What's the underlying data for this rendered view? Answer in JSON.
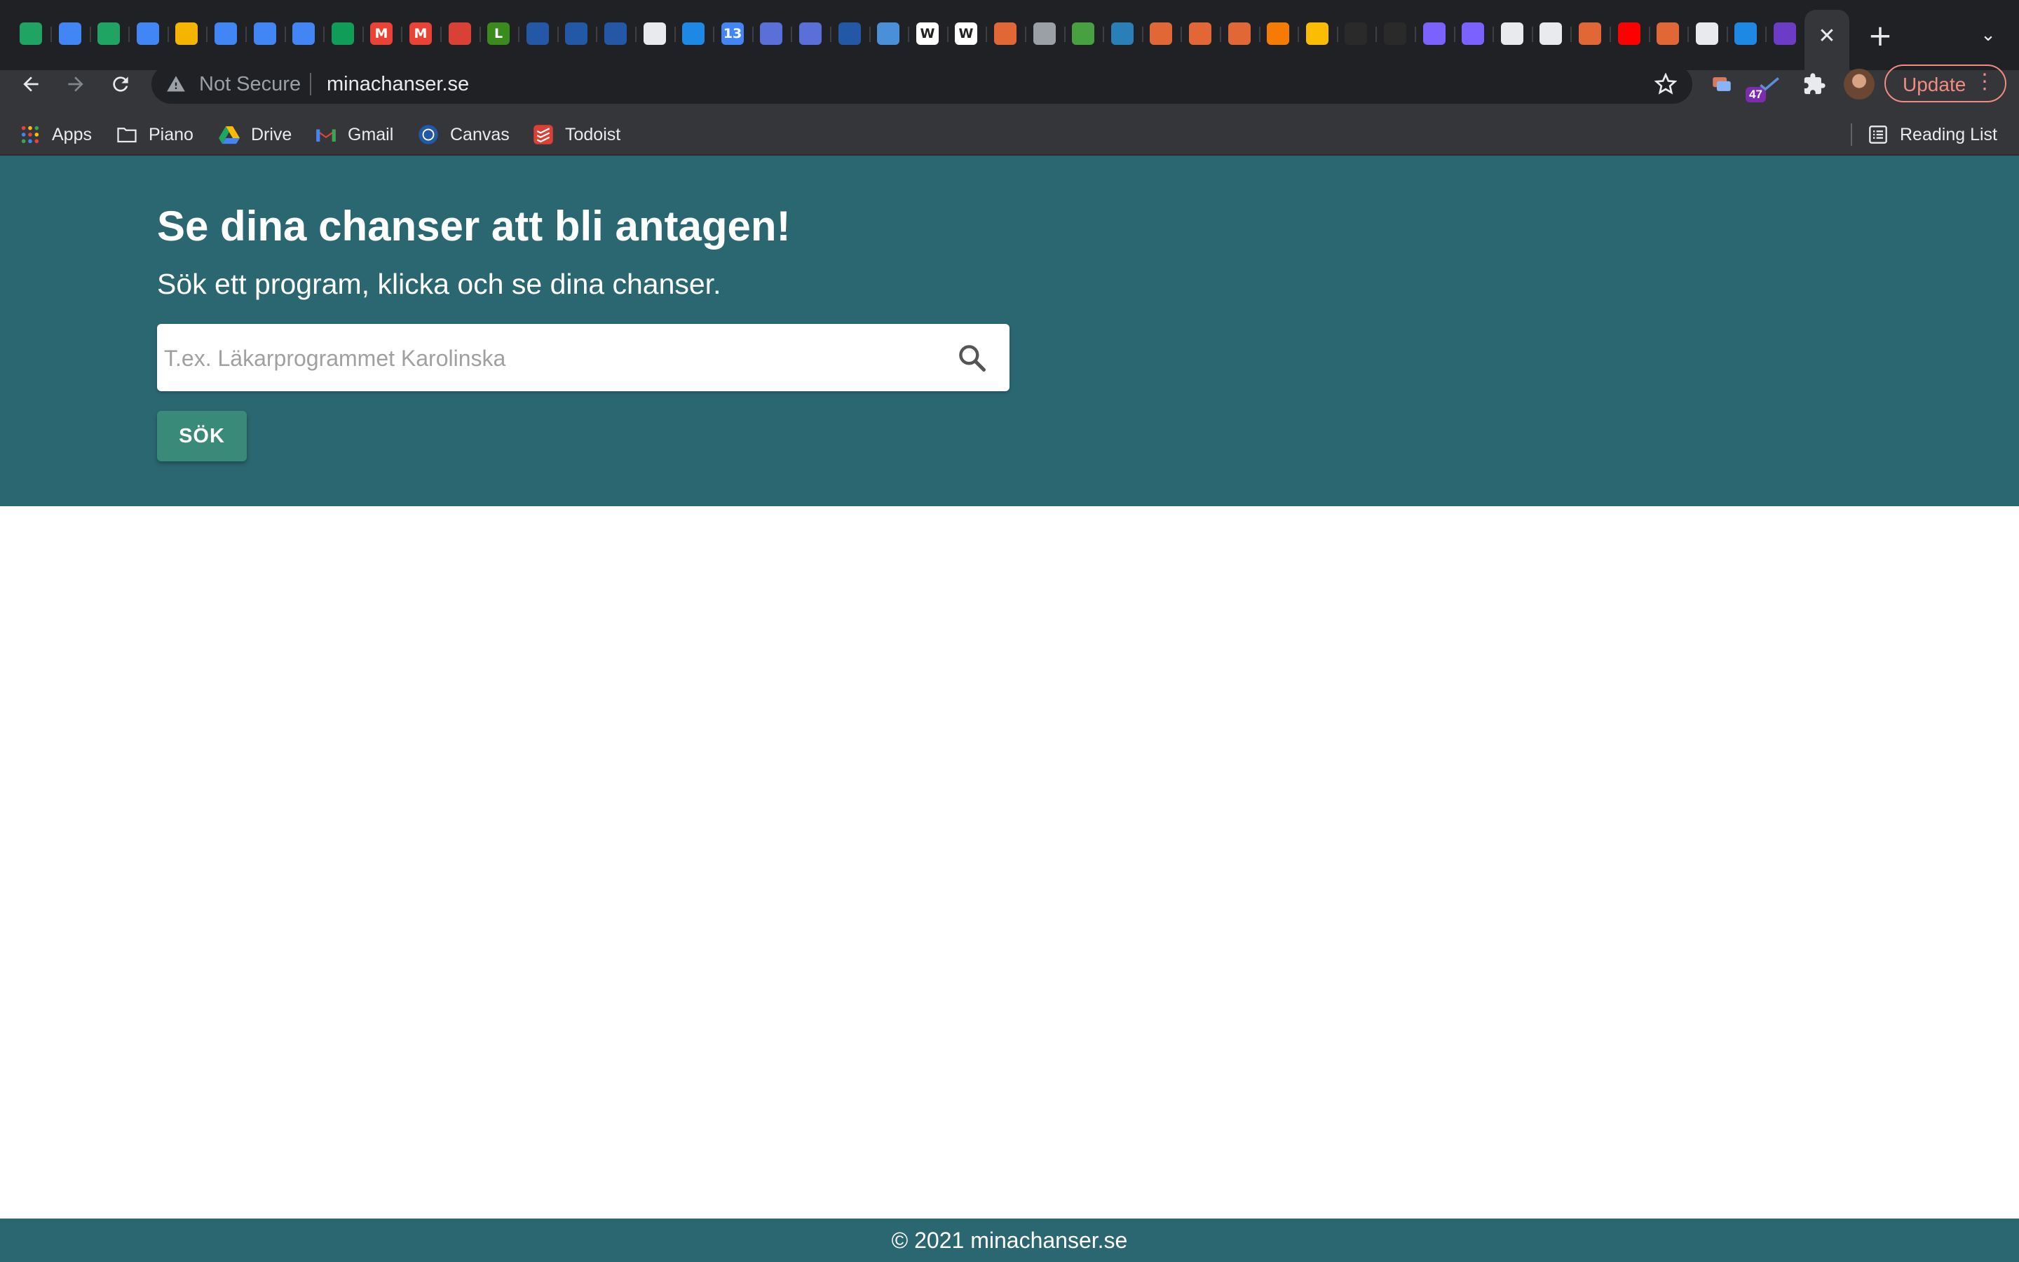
{
  "browser": {
    "tabs": [
      {
        "icon": "google-drive-icon",
        "color": "#1fa463",
        "glyph": ""
      },
      {
        "icon": "google-docs-icon",
        "color": "#4285f4",
        "glyph": ""
      },
      {
        "icon": "google-drive-icon",
        "color": "#1fa463",
        "glyph": ""
      },
      {
        "icon": "google-docs-icon",
        "color": "#4285f4",
        "glyph": ""
      },
      {
        "icon": "google-slides-icon",
        "color": "#f4b400",
        "glyph": ""
      },
      {
        "icon": "google-docs-icon",
        "color": "#4285f4",
        "glyph": ""
      },
      {
        "icon": "google-docs-icon",
        "color": "#4285f4",
        "glyph": ""
      },
      {
        "icon": "google-docs-icon",
        "color": "#4285f4",
        "glyph": ""
      },
      {
        "icon": "google-sheets-icon",
        "color": "#0f9d58",
        "glyph": ""
      },
      {
        "icon": "gmail-icon",
        "color": "#ea4335",
        "glyph": "M"
      },
      {
        "icon": "gmail-icon",
        "color": "#ea4335",
        "glyph": "M"
      },
      {
        "icon": "todoist-icon",
        "color": "#db4035",
        "glyph": ""
      },
      {
        "icon": "l-letter-icon",
        "color": "#3a8a1e",
        "glyph": "L"
      },
      {
        "icon": "kth-icon",
        "color": "#2258a5",
        "glyph": ""
      },
      {
        "icon": "kth-icon",
        "color": "#2258a5",
        "glyph": ""
      },
      {
        "icon": "kth-icon",
        "color": "#2258a5",
        "glyph": ""
      },
      {
        "icon": "globe-icon",
        "color": "#e8eaed",
        "glyph": ""
      },
      {
        "icon": "mail-app-icon",
        "color": "#1e88e5",
        "glyph": ""
      },
      {
        "icon": "calendar-icon",
        "color": "#4285f4",
        "glyph": "13"
      },
      {
        "icon": "butterfly-icon",
        "color": "#5b6fd8",
        "glyph": ""
      },
      {
        "icon": "butterfly-icon",
        "color": "#5b6fd8",
        "glyph": ""
      },
      {
        "icon": "kth-icon",
        "color": "#2258a5",
        "glyph": ""
      },
      {
        "icon": "pencil-icon",
        "color": "#4a90d9",
        "glyph": ""
      },
      {
        "icon": "wikipedia-icon",
        "color": "#ffffff",
        "glyph": "W"
      },
      {
        "icon": "wikipedia-icon",
        "color": "#ffffff",
        "glyph": "W"
      },
      {
        "icon": "matlab-icon",
        "color": "#e16737",
        "glyph": ""
      },
      {
        "icon": "globe-icon",
        "color": "#9aa0a6",
        "glyph": ""
      },
      {
        "icon": "overleaf-icon",
        "color": "#47a141",
        "glyph": ""
      },
      {
        "icon": "app-icon",
        "color": "#2a7fb8",
        "glyph": ""
      },
      {
        "icon": "matlab-icon",
        "color": "#e16737",
        "glyph": ""
      },
      {
        "icon": "matlab-icon",
        "color": "#e16737",
        "glyph": ""
      },
      {
        "icon": "matlab-icon",
        "color": "#e16737",
        "glyph": ""
      },
      {
        "icon": "gear-orange-icon",
        "color": "#f57c00",
        "glyph": ""
      },
      {
        "icon": "keep-icon",
        "color": "#fbbc04",
        "glyph": ""
      },
      {
        "icon": "dark-app-icon",
        "color": "#2a2a2a",
        "glyph": ""
      },
      {
        "icon": "dark-app-icon",
        "color": "#2a2a2a",
        "glyph": ""
      },
      {
        "icon": "messenger-icon",
        "color": "#7b61ff",
        "glyph": ""
      },
      {
        "icon": "purple-app-icon",
        "color": "#7b61ff",
        "glyph": ""
      },
      {
        "icon": "globe-icon",
        "color": "#e8eaed",
        "glyph": ""
      },
      {
        "icon": "globe-icon",
        "color": "#e8eaed",
        "glyph": ""
      },
      {
        "icon": "matlab-icon",
        "color": "#e16737",
        "glyph": ""
      },
      {
        "icon": "youtube-icon",
        "color": "#ff0000",
        "glyph": ""
      },
      {
        "icon": "matlab-icon",
        "color": "#e16737",
        "glyph": ""
      },
      {
        "icon": "github-icon",
        "color": "#e8eaed",
        "glyph": ""
      },
      {
        "icon": "sync-icon",
        "color": "#1e88e5",
        "glyph": ""
      },
      {
        "icon": "shield-purple-icon",
        "color": "#6c3cc7",
        "glyph": ""
      }
    ],
    "security_label": "Not Secure",
    "url": "minachanser.se",
    "extension_badge": "47",
    "update_label": "Update",
    "bookmarks": [
      {
        "label": "Apps",
        "icon": "apps-grid-icon"
      },
      {
        "label": "Piano",
        "icon": "folder-icon"
      },
      {
        "label": "Drive",
        "icon": "google-drive-icon"
      },
      {
        "label": "Gmail",
        "icon": "gmail-icon"
      },
      {
        "label": "Canvas",
        "icon": "kth-icon"
      },
      {
        "label": "Todoist",
        "icon": "todoist-icon"
      }
    ],
    "reading_list_label": "Reading List"
  },
  "page": {
    "title": "Se dina chanser att bli antagen!",
    "subtitle": "Sök ett program, klicka och se dina chanser.",
    "search_placeholder": "T.ex. Läkarprogrammet Karolinska",
    "search_value": "",
    "search_button_label": "SÖK",
    "footer_text": "© 2021 minachanser.se",
    "colors": {
      "hero_background": "#2b6770",
      "button_background": "#3a8a79",
      "footer_background": "#2b6770"
    }
  }
}
